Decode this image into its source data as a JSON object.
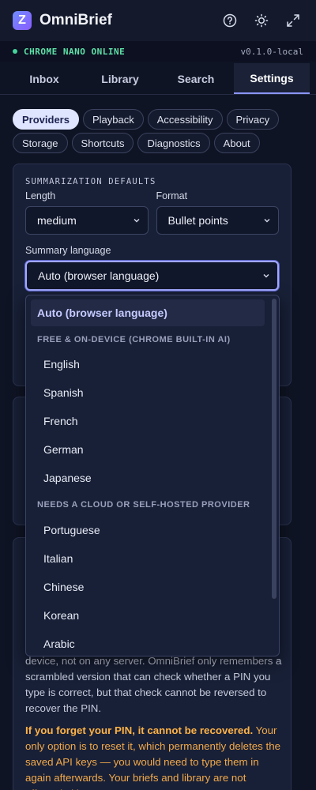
{
  "app": {
    "title": "OmniBrief",
    "logo_letter": "Z"
  },
  "header_icons": [
    "help-icon",
    "theme-sun-icon",
    "expand-icon"
  ],
  "status": {
    "text": "CHROME NANO ONLINE",
    "version": "v0.1.0-local"
  },
  "tabs": [
    {
      "label": "Inbox"
    },
    {
      "label": "Library"
    },
    {
      "label": "Search"
    },
    {
      "label": "Settings",
      "active": true
    }
  ],
  "pills": [
    {
      "label": "Providers",
      "active": true
    },
    {
      "label": "Playback"
    },
    {
      "label": "Accessibility"
    },
    {
      "label": "Privacy"
    },
    {
      "label": "Storage"
    },
    {
      "label": "Shortcuts"
    },
    {
      "label": "Diagnostics"
    },
    {
      "label": "About"
    }
  ],
  "summarization": {
    "section_title": "SUMMARIZATION DEFAULTS",
    "length_label": "Length",
    "length_value": "medium",
    "format_label": "Format",
    "format_value": "Bullet points",
    "language_label": "Summary language",
    "language_value": "Auto (browser language)"
  },
  "dropdown": {
    "selected": "Auto (browser language)",
    "group1": "FREE & ON-DEVICE (CHROME BUILT-IN AI)",
    "group1_items": [
      "English",
      "Spanish",
      "French",
      "German",
      "Japanese"
    ],
    "group2": "NEEDS A CLOUD OR SELF-HOSTED PROVIDER",
    "group2_items": [
      "Portuguese",
      "Italian",
      "Chinese",
      "Korean",
      "Arabic"
    ]
  },
  "pin_card": {
    "body": "device, not on any server. OmniBrief only remembers a scrambled version that can check whether a PIN you type is correct, but that check cannot be reversed to recover the PIN.",
    "warning_bold": "If you forget your PIN, it cannot be recovered.",
    "warning_rest": " Your only option is to reset it, which permanently deletes the saved API keys — you would need to type them in again afterwards. Your briefs and library are not affected either way."
  },
  "colors": {
    "accent": "#8b95ff",
    "status_green": "#5fe0a8",
    "warning": "#f2a94a"
  }
}
